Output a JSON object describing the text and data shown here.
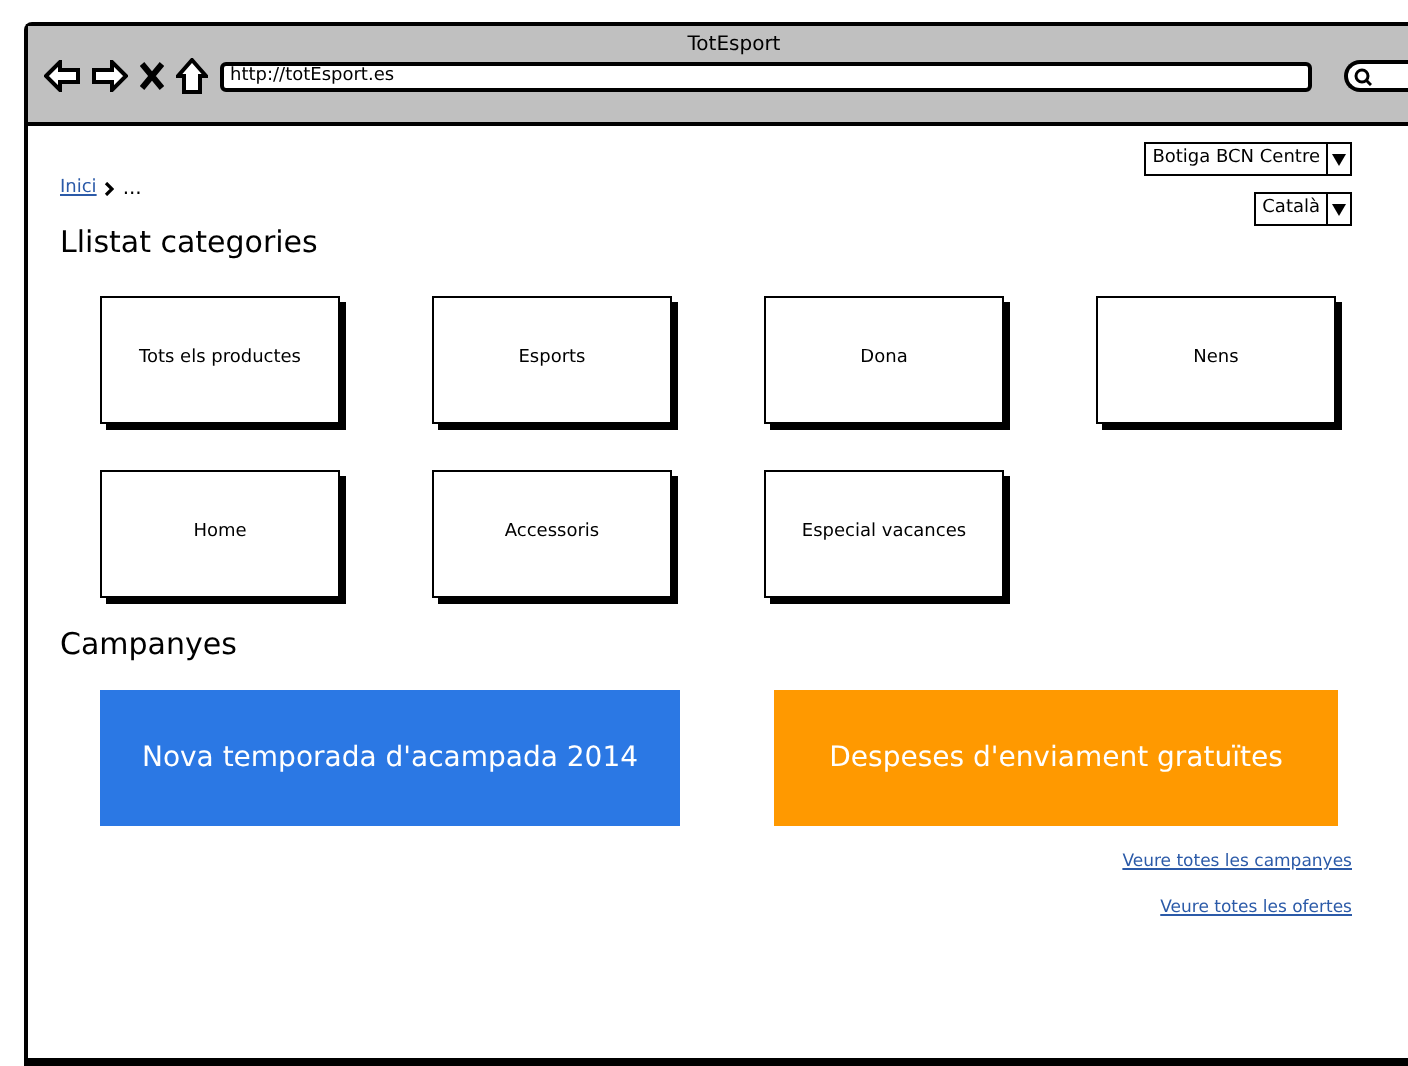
{
  "window": {
    "title": "TotEsport",
    "url": "http://totEsport.es"
  },
  "selectors": [
    {
      "value": "Botiga BCN Centre"
    },
    {
      "value": "Català"
    }
  ],
  "breadcrumb": {
    "items": [
      "Inici",
      "..."
    ]
  },
  "categories_title": "Llistat categories",
  "categories": [
    "Tots els productes",
    "Esports",
    "Dona",
    "Nens",
    "Home",
    "Accessoris",
    "Especial vacances"
  ],
  "campaigns_title": "Campanyes",
  "campaigns": [
    {
      "text": "Nova temporada d'acampada 2014",
      "color": "#2b78e4"
    },
    {
      "text": "Despeses d'enviament gratuïtes",
      "color": "#ff9900"
    }
  ],
  "links": [
    "Veure totes les campanyes",
    "Veure totes les ofertes"
  ]
}
